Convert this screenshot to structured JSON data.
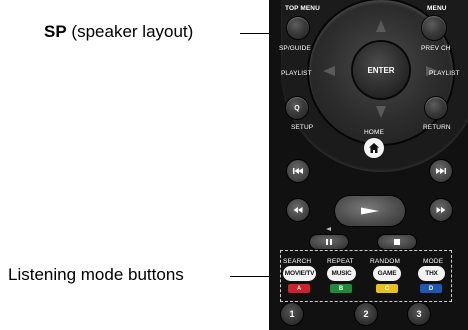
{
  "callouts": {
    "sp_bold": "SP",
    "sp_rest": "(speaker layout)",
    "listening": "Listening mode buttons"
  },
  "remote": {
    "top_menu": "TOP MENU",
    "sp_guide": "SP/GUIDE",
    "menu": "MENU",
    "prev_ch": "PREV CH",
    "playlist_left": "PLAYLIST",
    "playlist_right": "PLAYLIST",
    "enter": "ENTER",
    "q_button": "Q",
    "setup": "SETUP",
    "home": "HOME",
    "return": "RETURN",
    "modes": {
      "search": "SEARCH",
      "repeat": "REPEAT",
      "random": "RANDOM",
      "mode": "MODE"
    },
    "mode_buttons": {
      "movie_tv": "MOVIE/TV",
      "music": "MUSIC",
      "game": "GAME",
      "thx": "THX"
    },
    "color_keys": {
      "a": "A",
      "b": "B",
      "c": "C",
      "d": "D"
    },
    "numbers": {
      "one": "1",
      "two": "2",
      "three": "3"
    }
  },
  "colors": {
    "remote_body": "#111111",
    "key_red": "#d0202a",
    "key_green": "#1f8a3c",
    "key_yellow": "#e6c21a",
    "key_blue": "#1f57b5"
  }
}
